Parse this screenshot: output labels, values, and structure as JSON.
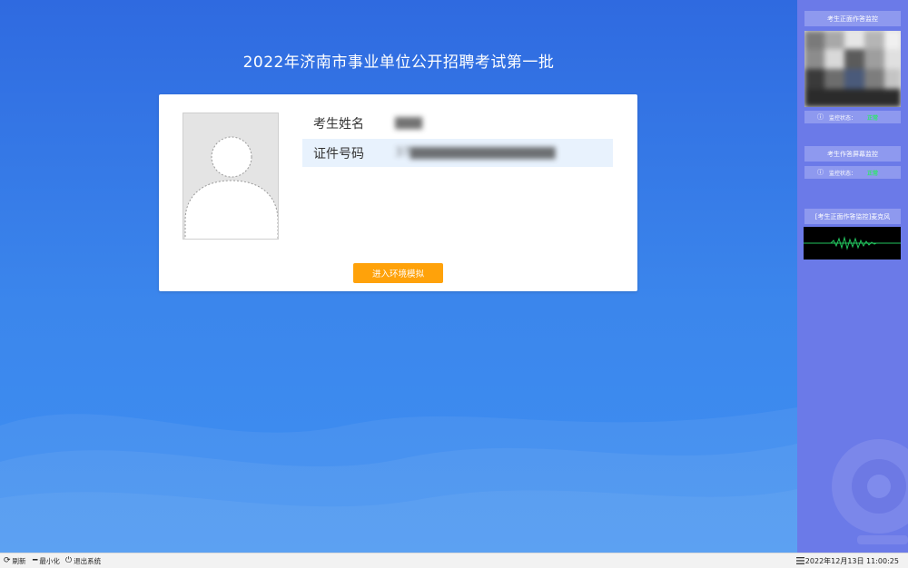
{
  "exam": {
    "title": "2022年济南市事业单位公开招聘考试第一批"
  },
  "candidate": {
    "name_label": "考生姓名",
    "name_value": "▇▇▇",
    "id_label": "证件号码",
    "id_value": "37▇▇▇▇▇▇▇▇▇▇▇▇▇▇▇▇"
  },
  "actions": {
    "enter_simulation": "进入环境模拟"
  },
  "side_panel": {
    "front_monitor_title": "考生正面作答监控",
    "front_status_label": "监控状态：",
    "front_status_value": "正常",
    "screen_monitor_title": "考生作答屏幕监控",
    "screen_status_label": "监控状态：",
    "screen_status_value": "正常",
    "mic_title": "[考生正面作答监控]麦克风"
  },
  "taskbar": {
    "refresh_label": "刷新",
    "minimize_label": "最小化",
    "exit_label": "退出系统",
    "datetime": "2022年12月13日 11:00:25"
  },
  "colors": {
    "background_top": "#2f6ae0",
    "background_bottom": "#3f90f2",
    "side_panel": "#6b7ae8",
    "accent_button": "#ffa20a",
    "status_ok": "#2ee86a",
    "mic_wave": "#22c55e"
  },
  "icons": {
    "refresh": "refresh-icon",
    "minimize": "minimize-icon",
    "exit": "power-icon",
    "info": "info-icon",
    "menu": "menu-icon",
    "webcam": "webcam-icon",
    "avatar": "avatar-placeholder-icon"
  }
}
